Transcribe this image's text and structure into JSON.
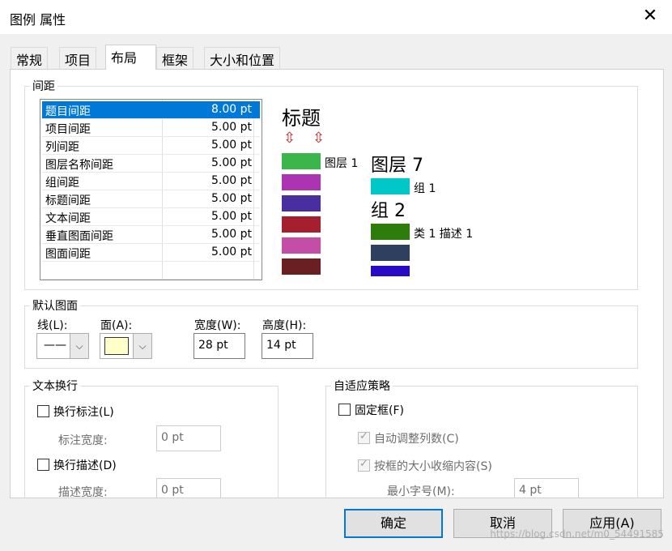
{
  "window": {
    "title": "图例 属性",
    "close_glyph": "✕"
  },
  "tabs": [
    "常规",
    "项目",
    "布局",
    "框架",
    "大小和位置"
  ],
  "spacing": {
    "group_label": "间距",
    "rows": [
      {
        "name": "题目间距",
        "value": "8.00 pt"
      },
      {
        "name": "项目间距",
        "value": "5.00 pt"
      },
      {
        "name": "列间距",
        "value": "5.00 pt"
      },
      {
        "name": "图层名称间距",
        "value": "5.00 pt"
      },
      {
        "name": "组间距",
        "value": "5.00 pt"
      },
      {
        "name": "标题间距",
        "value": "5.00 pt"
      },
      {
        "name": "文本间距",
        "value": "5.00 pt"
      },
      {
        "name": "垂直图面间距",
        "value": "5.00 pt"
      },
      {
        "name": "图面间距",
        "value": "5.00 pt"
      }
    ]
  },
  "preview": {
    "title": "标题",
    "arrow_glyph": "⇳",
    "layer1_label": "图层 1",
    "layer7_label": "图层 7",
    "group1_label": "组 1",
    "group2_label": "组 2",
    "class_label": "类 1 描述 1",
    "colors_left": [
      "#3cb54a",
      "#ab34b2",
      "#4a2ea0",
      "#a51f2e",
      "#c44ea6",
      "#6a1f23"
    ],
    "colors_right": [
      "#00c8c8",
      "#2e7d0c",
      "#2f3f60",
      "#2a0bc5"
    ]
  },
  "default_patch": {
    "group_label": "默认图面",
    "line_label": "线(L):",
    "line_value": "——",
    "area_label": "面(A):",
    "area_color": "#ffffc8",
    "width_label": "宽度(W):",
    "width_value": "28 pt",
    "height_label": "高度(H):",
    "height_value": "14 pt",
    "dropdown_glyph": "⌵"
  },
  "text_wrap": {
    "group_label": "文本换行",
    "wrap_label": "换行标注(L)",
    "label_width_label": "标注宽度:",
    "label_width_value": "0 pt",
    "wrap_desc": "换行描述(D)",
    "desc_width_label": "描述宽度:",
    "desc_width_value": "0 pt"
  },
  "fitting": {
    "group_label": "自适应策略",
    "fixed_frame": "固定框(F)",
    "auto_columns": "自动调整列数(C)",
    "shrink_contents": "按框的大小收缩内容(S)",
    "min_font_label": "最小字号(M):",
    "min_font_value": "4 pt"
  },
  "buttons": {
    "ok": "确定",
    "cancel": "取消",
    "apply": "应用(A)"
  },
  "watermark": "https://blog.csdn.net/m0_54491585"
}
